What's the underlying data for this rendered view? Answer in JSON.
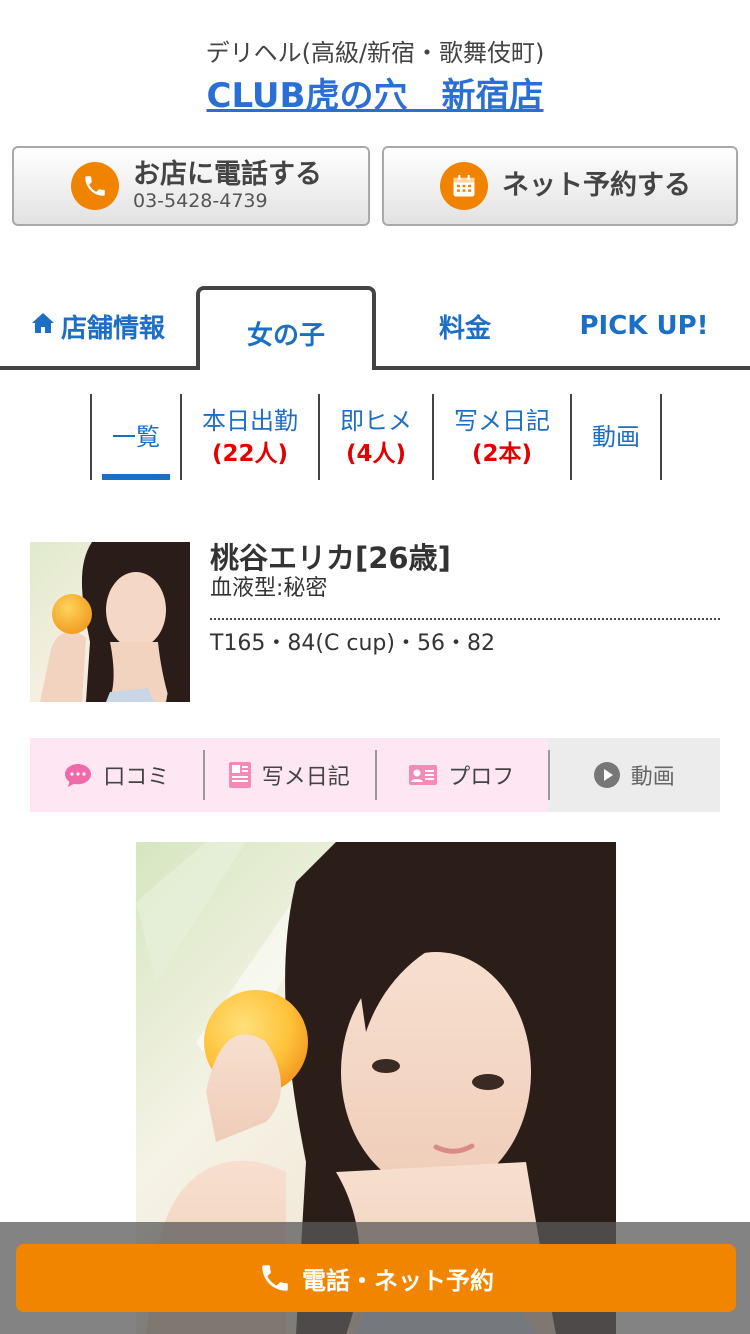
{
  "header": {
    "subtitle": "デリヘル(高級/新宿・歌舞伎町)",
    "shop_name": "CLUB虎の穴　新宿店"
  },
  "cta": {
    "tel_label": "お店に電話する",
    "tel_number": "03-5428-4739",
    "web_label": "ネット予約する"
  },
  "tabs": [
    {
      "label": "店舗情報",
      "icon": "home-icon"
    },
    {
      "label": "女の子",
      "active": true
    },
    {
      "label": "料金"
    },
    {
      "label": "PICK UP!"
    }
  ],
  "subnav": [
    {
      "label": "一覧",
      "count": "",
      "active": true
    },
    {
      "label": "本日出勤",
      "count": "(22人)"
    },
    {
      "label": "即ヒメ",
      "count": "(4人)"
    },
    {
      "label": "写メ日記",
      "count": "(2本)"
    },
    {
      "label": "動画",
      "count": ""
    }
  ],
  "profile": {
    "name": "桃谷エリカ[26歳]",
    "blood": "血液型:秘密",
    "size": "T165・84(C cup)・56・82"
  },
  "actions": [
    {
      "label": "口コミ",
      "icon": "review-bubble-icon"
    },
    {
      "label": "写メ日記",
      "icon": "photo-diary-icon"
    },
    {
      "label": "プロフ",
      "icon": "profile-card-icon"
    },
    {
      "label": "動画",
      "icon": "play-icon"
    }
  ],
  "bottom": {
    "label": "電話・ネット予約"
  },
  "colors": {
    "link_blue": "#1c6fc4",
    "accent_orange": "#f08300",
    "count_red": "#e30000",
    "action_pink": "#ffe6f3"
  }
}
